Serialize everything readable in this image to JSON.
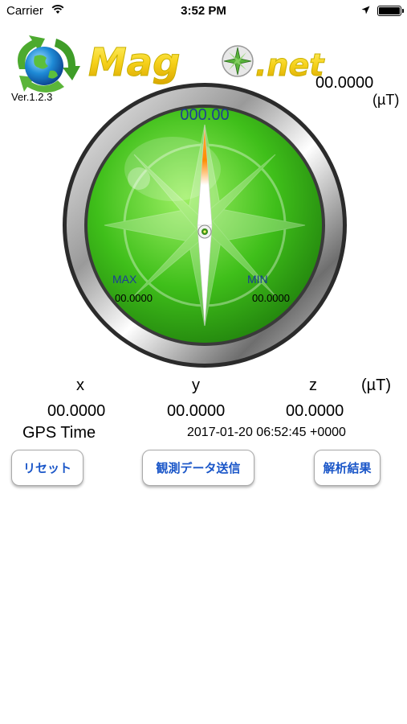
{
  "status_bar": {
    "carrier": "Carrier",
    "time": "3:52 PM",
    "wifi_icon": "wifi-icon",
    "location_icon": "location-arrow-icon",
    "battery_icon": "battery-full-icon"
  },
  "header": {
    "logo_icon": "recycle-globe-icon",
    "brand": "Mag",
    "brand_suffix": ".net",
    "version": "Ver.1.2.3",
    "total_value": "00.0000",
    "total_unit": "(µT)"
  },
  "compass": {
    "heading": "000.00",
    "max_label": "MAX",
    "max_value": "00.0000",
    "min_label": "MIN",
    "min_value": "00.0000",
    "face_color": "#3fbf1a",
    "needle_tip_color": "#ff8c00"
  },
  "axes": {
    "x_label": "x",
    "y_label": "y",
    "z_label": "z",
    "unit": "(µT)",
    "x_value": "00.0000",
    "y_value": "00.0000",
    "z_value": "00.0000"
  },
  "gps": {
    "label": "GPS Time",
    "value": "2017-01-20 06:52:45 +0000"
  },
  "buttons": {
    "reset": "リセット",
    "send": "観測データ送信",
    "result": "解析結果"
  },
  "colors": {
    "button_text": "#1a56c8",
    "label_blue": "#1b3c99",
    "brand_yellow": "#f6d11a"
  }
}
